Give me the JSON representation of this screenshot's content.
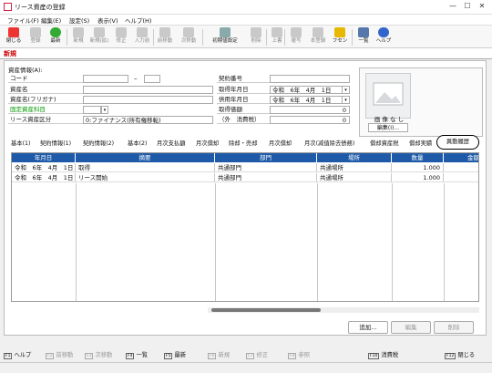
{
  "window": {
    "title": "リース資産の登録"
  },
  "menu": [
    "ファイル(F)",
    "編集(E)",
    "設定(S)",
    "表示(V)",
    "ヘルプ(H)"
  ],
  "toolbar": {
    "close": "閉じる",
    "register": "登録",
    "latest": "最新",
    "new": "新規",
    "new_copy": "新規(拡)",
    "modify": "修正",
    "entry": "入力前",
    "prev": "前移動",
    "next": "次移動",
    "init_settings": "初期値設定",
    "delete": "削除",
    "overwrite": "上書",
    "copy": "複写",
    "register2": "本登録",
    "fusen": "フセン",
    "list": "一覧",
    "help": "ヘルプ"
  },
  "mode": "新規",
  "form": {
    "section_label": "資産情報(A):",
    "code_label": "コード",
    "code_value": "",
    "code_dash": "–",
    "code_suffix": "",
    "name_label": "資産名",
    "name_value": "",
    "kana_label": "資産名(フリガナ)",
    "kana_value": "",
    "account_label": "固定資産科目",
    "account_value": "",
    "category_label": "リース資産区分",
    "category_value": "0:ファイナンス(所有権移転)",
    "contract_label": "契約番号",
    "contract_value": "",
    "acq_date_label": "取得年月日",
    "acq_date_value": "令和　6年　4月　1日",
    "use_date_label": "供用年月日",
    "use_date_value": "令和　6年　4月　1日",
    "price_label": "取得価額",
    "price_value": "0",
    "tax_label": "（外　消費税）",
    "tax_value": "0"
  },
  "image": {
    "no_image": "画 像 な し",
    "edit_button": "編集(I)..."
  },
  "tabs": [
    "基本(1)",
    "契約情報(1)",
    "契約情報(2)",
    "基本(2)",
    "月次支払額",
    "月次償却",
    "除却・売却",
    "月次償却",
    "月次(减值除去债務)",
    "償却資産税",
    "償却実績"
  ],
  "active_tab": "異動履歴",
  "grid": {
    "headers": [
      "年月日",
      "摘要",
      "部門",
      "場所",
      "数量",
      "金額"
    ],
    "rows": [
      [
        "令和　6年　4月　1日",
        "取得",
        "共通部門",
        "共通場所",
        "1.000",
        ""
      ],
      [
        "令和　6年　4月　1日",
        "リース開始",
        "共通部門",
        "共通場所",
        "1.000",
        ""
      ]
    ]
  },
  "buttons": {
    "add": "追加...",
    "edit": "編集",
    "delete": "削除"
  },
  "fkeys": [
    {
      "key": "F1",
      "label": "ヘルプ"
    },
    {
      "key": "F2",
      "label": "前移動"
    },
    {
      "key": "F3",
      "label": "次移動"
    },
    {
      "key": "F4",
      "label": "一覧"
    },
    {
      "key": "F5",
      "label": "最新"
    },
    {
      "key": "F6",
      "label": "新規"
    },
    {
      "key": "F7",
      "label": "修正"
    },
    {
      "key": "F8",
      "label": "参照"
    },
    {
      "key": "F10",
      "label": "消費税"
    },
    {
      "key": "F12",
      "label": "閉じる"
    }
  ],
  "colors": {
    "accent": "#1e5aa8",
    "mode_red": "#cc0000",
    "green_label": "#009900"
  }
}
